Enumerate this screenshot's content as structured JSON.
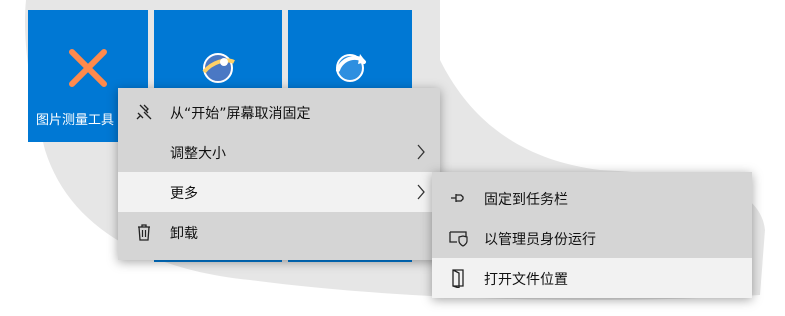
{
  "tiles": [
    {
      "label": "图片测量工具",
      "icon": "close-x-icon"
    },
    {
      "label": "",
      "icon": "app-globe-icon"
    },
    {
      "label": "",
      "icon": "refresh-globe-icon"
    }
  ],
  "context_menu": {
    "items": [
      {
        "label": "从“开始”屏幕取消固定",
        "icon": "unpin-icon"
      },
      {
        "label": "调整大小",
        "icon": "",
        "has_submenu": true
      },
      {
        "label": "更多",
        "icon": "",
        "has_submenu": true,
        "highlighted": true
      },
      {
        "label": "卸载",
        "icon": "trash-icon"
      }
    ]
  },
  "submenu": {
    "items": [
      {
        "label": "固定到任务栏",
        "icon": "pin-icon"
      },
      {
        "label": "以管理员身份运行",
        "icon": "shield-window-icon"
      },
      {
        "label": "打开文件位置",
        "icon": "open-folder-icon",
        "highlighted": true
      }
    ]
  },
  "colors": {
    "tile_blue": "#0078d4",
    "menu_bg": "#d5d5d5",
    "highlight": "#f2f2f2",
    "accent_orange": "#ff8a4c"
  }
}
